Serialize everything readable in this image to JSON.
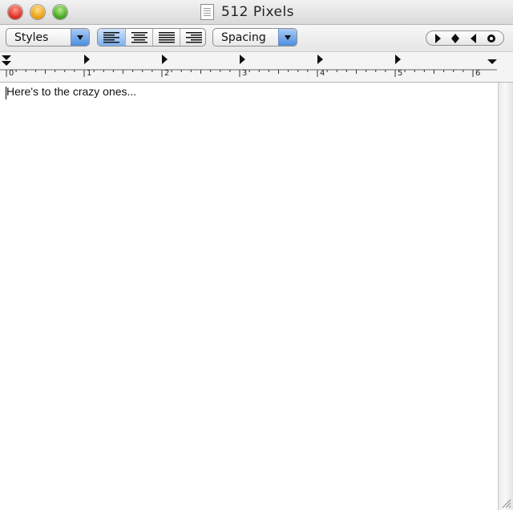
{
  "window": {
    "title": "512 Pixels"
  },
  "toolbar": {
    "styles_label": "Styles",
    "spacing_label": "Spacing",
    "alignment": [
      "left-align",
      "center-align",
      "justify-align",
      "right-align"
    ],
    "selected_alignment": "left-align",
    "navigation": [
      "play-icon",
      "diamond-icon",
      "back-icon",
      "record-icon"
    ]
  },
  "ruler": {
    "numbers": [
      "0",
      "1",
      "2",
      "3",
      "4",
      "5",
      "6"
    ]
  },
  "document": {
    "text": "Here's to the crazy ones..."
  },
  "colors": {
    "accent": "#4c8ce0",
    "selected_button": "#7fb0ee"
  }
}
